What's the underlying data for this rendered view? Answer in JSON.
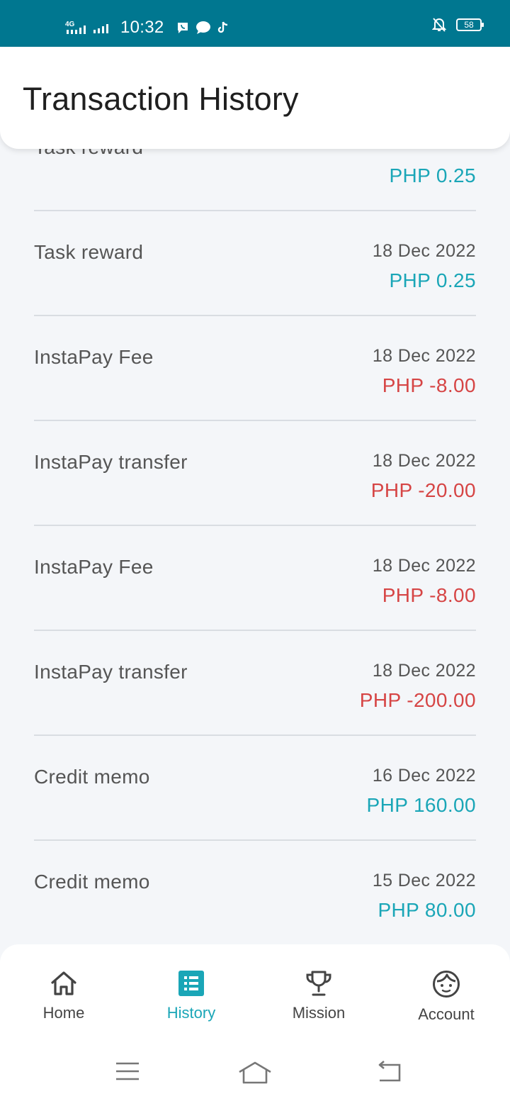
{
  "status_bar": {
    "network": "4G",
    "time": "10:32",
    "battery": "58",
    "icons": [
      "signal-icon",
      "viber-icon",
      "chat-icon",
      "tiktok-icon",
      "mute-icon",
      "battery-icon"
    ]
  },
  "header": {
    "title": "Transaction History"
  },
  "transactions": [
    {
      "label": "Task reward",
      "date": "",
      "amount": "PHP 0.25",
      "kind": "pos"
    },
    {
      "label": "Task reward",
      "date": "18 Dec 2022",
      "amount": "PHP 0.25",
      "kind": "pos"
    },
    {
      "label": "InstaPay Fee",
      "date": "18 Dec 2022",
      "amount": "PHP -8.00",
      "kind": "neg"
    },
    {
      "label": "InstaPay transfer",
      "date": "18 Dec 2022",
      "amount": "PHP -20.00",
      "kind": "neg"
    },
    {
      "label": "InstaPay Fee",
      "date": "18 Dec 2022",
      "amount": "PHP -8.00",
      "kind": "neg"
    },
    {
      "label": "InstaPay transfer",
      "date": "18 Dec 2022",
      "amount": "PHP -200.00",
      "kind": "neg"
    },
    {
      "label": "Credit memo",
      "date": "16 Dec 2022",
      "amount": "PHP 160.00",
      "kind": "pos"
    },
    {
      "label": "Credit memo",
      "date": "15 Dec 2022",
      "amount": "PHP 80.00",
      "kind": "pos"
    }
  ],
  "colors": {
    "status_bar": "#007790",
    "accent": "#1aa6b7",
    "negative": "#d64545"
  },
  "nav": {
    "home": {
      "label": "Home",
      "icon": "home-icon"
    },
    "history": {
      "label": "History",
      "icon": "list-icon",
      "active": true
    },
    "mission": {
      "label": "Mission",
      "icon": "trophy-icon"
    },
    "account": {
      "label": "Account",
      "icon": "face-icon"
    }
  }
}
